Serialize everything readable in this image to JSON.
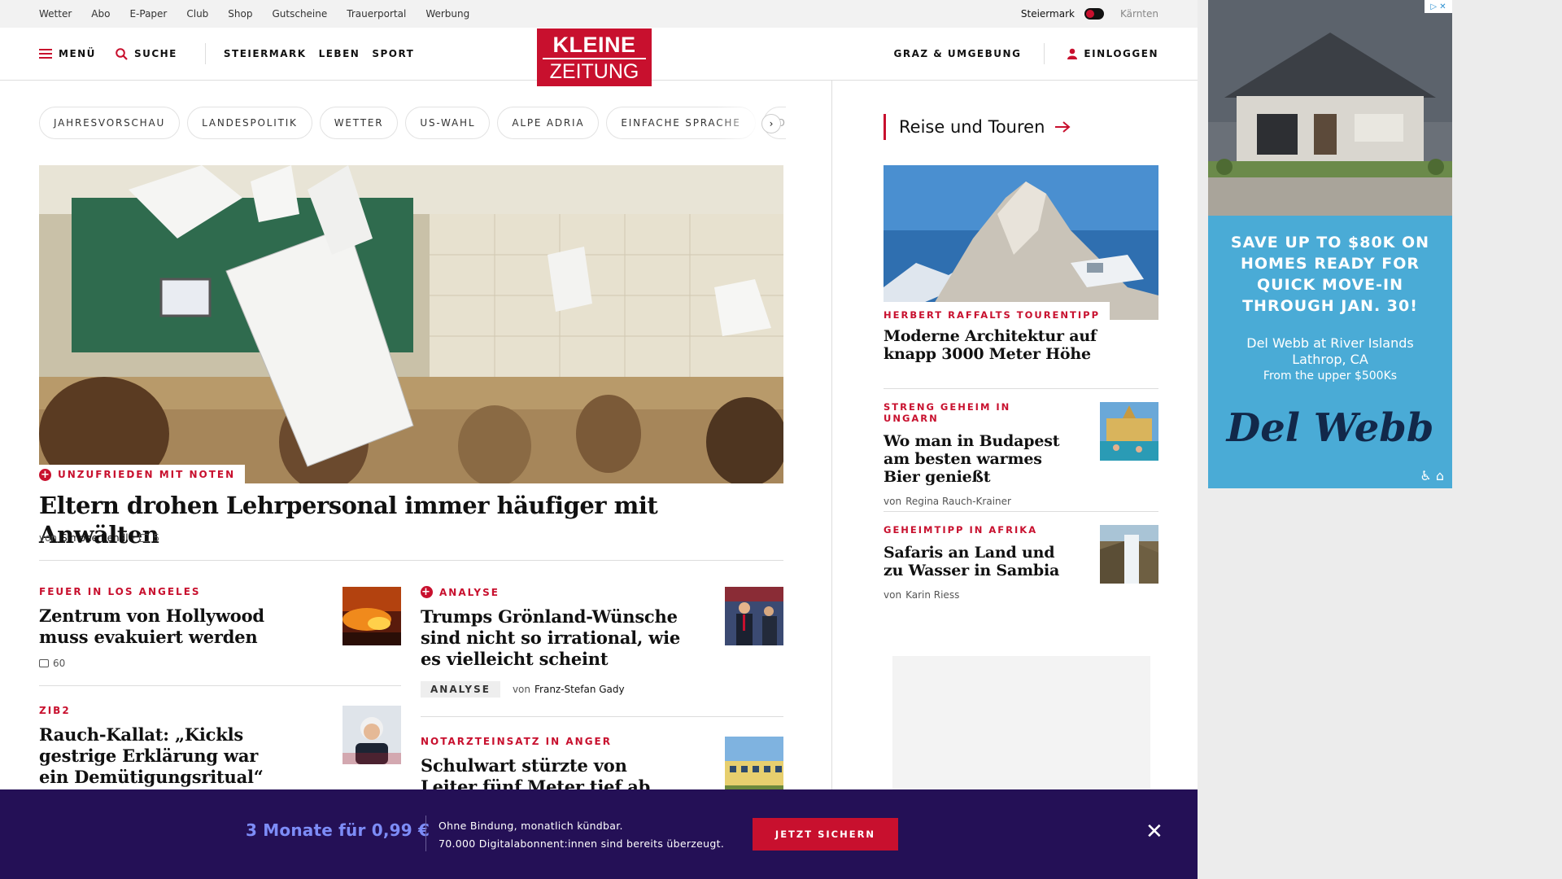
{
  "topbar": {
    "links": [
      "Wetter",
      "Abo",
      "E-Paper",
      "Club",
      "Shop",
      "Gutscheine",
      "Trauerportal",
      "Werbung"
    ],
    "region_left": "Steiermark",
    "region_right": "Kärnten"
  },
  "header": {
    "menu_label": "MENÜ",
    "search_label": "SUCHE",
    "nav": [
      "STEIERMARK",
      "LEBEN",
      "SPORT"
    ],
    "region_link": "GRAZ & UMGEBUNG",
    "login_label": "EINLOGGEN",
    "logo_line1": "KLEINE",
    "logo_line2": "ZEITUNG"
  },
  "tags": [
    "JAHRESVORSCHAU",
    "LANDESPOLITIK",
    "WETTER",
    "US-WAHL",
    "ALPE ADRIA",
    "EINFACHE SPRACHE",
    "DOS"
  ],
  "hero": {
    "kicker": "UNZUFRIEDEN MIT NOTEN",
    "title": "Eltern drohen Lehrpersonal immer häufiger mit Anwälten",
    "by": "von",
    "author": "Simone Rendl",
    "comments": "5"
  },
  "articles": {
    "a1": {
      "kicker": "FEUER IN LOS ANGELES",
      "title": "Zentrum von Hollywood muss evakuiert werden",
      "comments": "60"
    },
    "a2": {
      "kicker": "ANALYSE",
      "title": "Trumps Grönland-Wünsche sind nicht so irrational, wie es vielleicht scheint",
      "tag": "ANALYSE",
      "by": "von",
      "author": "Franz-Stefan Gady"
    },
    "a3": {
      "kicker": "ZIB2",
      "title": "Rauch-Kallat: „Kickls gestrige Erklärung war ein Demütigungsritual“"
    },
    "a4": {
      "kicker": "NOTARZTEINSATZ IN ANGER",
      "title": "Schulwart stürzte von Leiter fünf Meter tief ab"
    }
  },
  "sidebar": {
    "section_title": "Reise und Touren",
    "lead": {
      "kicker": "HERBERT RAFFALTS TOURENTIPP",
      "title": "Moderne Architektur auf knapp 3000 Meter Höhe"
    },
    "items": [
      {
        "kicker": "STRENG GEHEIM IN UNGARN",
        "title": "Wo man in Budapest am besten warmes Bier genießt",
        "by": "von",
        "author": "Regina Rauch-Krainer"
      },
      {
        "kicker": "GEHEIMTIPP IN AFRIKA",
        "title": "Safaris an Land und zu Wasser in Sambia",
        "by": "von",
        "author": "Karin Riess"
      }
    ]
  },
  "ad": {
    "headline": "SAVE UP TO $80K ON HOMES READY FOR QUICK MOVE-IN THROUGH JAN. 30!",
    "location": "Del Webb at River Islands Lathrop, CA",
    "price": "From the upper $500Ks",
    "brand": "Del Webb"
  },
  "banner": {
    "offer": "3 Monate für 0,99 €",
    "line1": "Ohne Bindung, monatlich kündbar.",
    "line2": "70.000 Digitalabonnent:innen sind bereits überzeugt.",
    "cta": "JETZT SICHERN"
  },
  "colors": {
    "brand_red": "#c8102e",
    "banner_bg": "#241056",
    "offer_blue": "#7d8cf7",
    "ad_blue": "#4aabd6"
  },
  "icons": [
    "hamburger-icon",
    "search-icon",
    "user-icon",
    "plus-icon",
    "comment-icon",
    "arrow-right-icon",
    "chevron-right-icon",
    "close-icon",
    "adchoices-icon",
    "accessibility-icon"
  ]
}
